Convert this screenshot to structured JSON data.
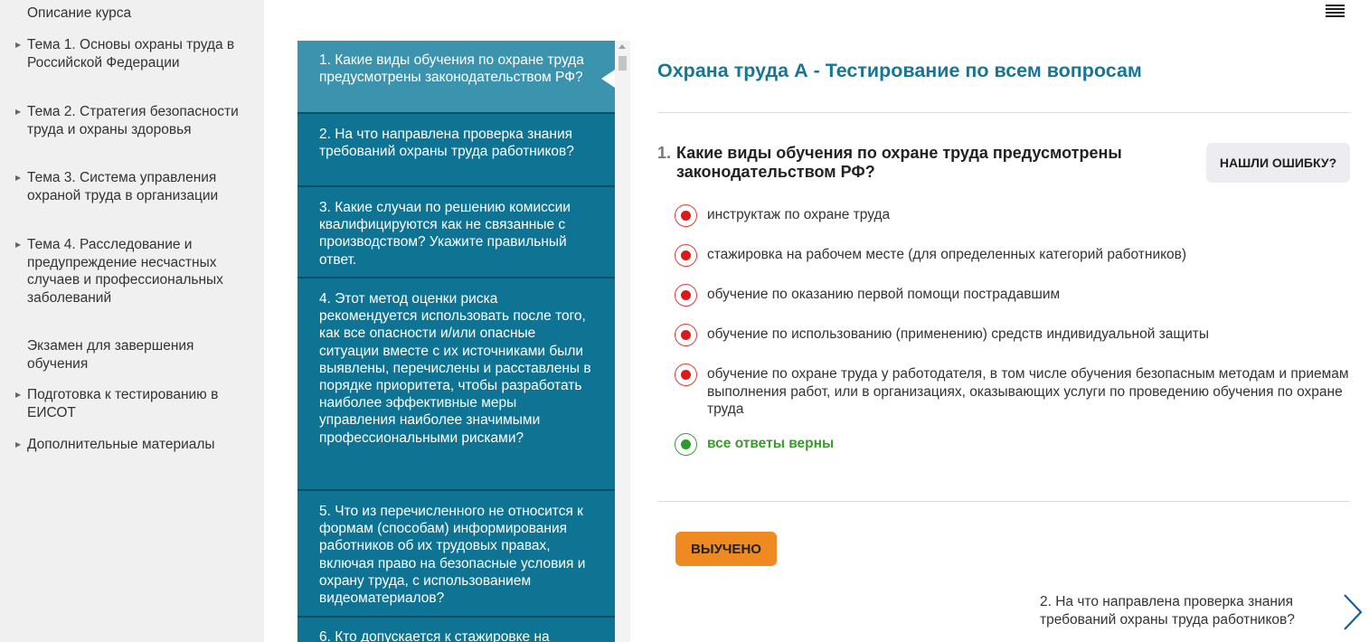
{
  "sidebar": {
    "items": [
      {
        "label": "Описание курса",
        "has_arrow": false
      },
      {
        "label": "Тема 1. Основы охраны труда в Российской Федерации",
        "has_arrow": true
      },
      {
        "label": "Тема 2. Стратегия безопасности труда и охраны здоровья",
        "has_arrow": true
      },
      {
        "label": "Тема 3. Система управления охраной труда в организации",
        "has_arrow": true
      },
      {
        "label": "Тема 4. Расследование и предупреждение несчастных случаев и профессиональных заболеваний",
        "has_arrow": true
      },
      {
        "label": "Экзамен для завершения обучения",
        "has_arrow": false
      },
      {
        "label": "Подготовка к тестированию в ЕИСОТ",
        "has_arrow": true
      },
      {
        "label": "Дополнительные материалы",
        "has_arrow": true
      }
    ]
  },
  "question_list": [
    "1. Какие виды обучения по охране труда предусмотрены законодательством РФ?",
    "2. На что направлена проверка знания требований охраны труда работников?",
    "3. Какие случаи по решению комиссии квалифицируются как не связанные с производством? Укажите правильный ответ.",
    "4. Этот метод оценки риска рекомендуется использовать после того, как все опасности и/или опасные ситуации вместе с их источниками были выявлены, перечислены и расставлены в порядке приоритета, чтобы разработать наиболее эффективные меры управления наиболее значимыми профессиональными рисками?",
    "5. Что из перечисленного не относится к формам (способам) информирования работников об их трудовых правах, включая право на безопасные условия и охрану труда, с использованием видеоматериалов?",
    "6. Кто допускается к стажировке на"
  ],
  "main": {
    "title": "Охрана труда А - Тестирование по всем вопросам",
    "question_number": "1.",
    "question_text": "Какие виды обучения по охране труда предусмотрены законодательством РФ?",
    "report_error_label": "НАШЛИ ОШИБКУ?",
    "answers": [
      {
        "text": "инструктаж по охране труда",
        "correct": false
      },
      {
        "text": "стажировка на рабочем месте (для определенных категорий работников)",
        "correct": false
      },
      {
        "text": "обучение по оказанию первой помощи пострадавшим",
        "correct": false
      },
      {
        "text": "обучение по использованию (применению) средств индивидуальной защиты",
        "correct": false
      },
      {
        "text": "обучение по охране труда у работодателя, в том числе обучения безопасным методам и приемам выполнения работ, или в организациях, оказывающих услуги по проведению обучения по охране труда",
        "correct": false
      },
      {
        "text": "все ответы верны",
        "correct": true
      }
    ],
    "learned_label": "ВЫУЧЕНО",
    "next_question": "2. На что направлена проверка знания требований охраны труда работников?"
  },
  "colors": {
    "accent": "#1a7594",
    "list_bg": "#0f7393",
    "list_active": "#3c93ad",
    "learned_button": "#ef8a22",
    "correct": "#3a9a2b",
    "radio_red": "#e01818"
  }
}
